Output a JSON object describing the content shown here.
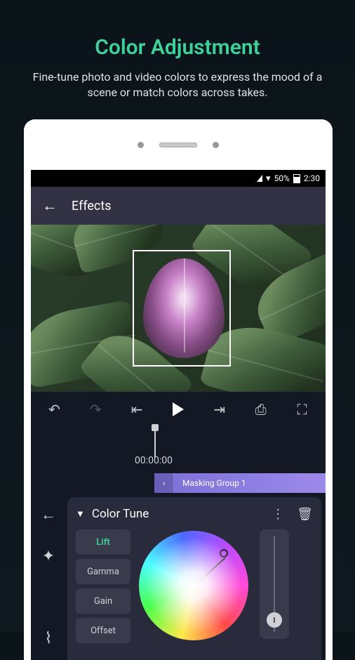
{
  "promo": {
    "title": "Color Adjustment",
    "subtitle": "Fine-tune photo and video colors to express the mood of a scene or match colors across takes."
  },
  "statusbar": {
    "battery": "50%",
    "time": "2:30"
  },
  "header": {
    "title": "Effects"
  },
  "timeline": {
    "timecode": "00:00:00",
    "track_name": "Masking Group 1"
  },
  "panel": {
    "title": "Color Tune",
    "tabs": [
      "Lift",
      "Gamma",
      "Gain",
      "Offset"
    ],
    "active_tab": "Lift"
  },
  "icons": {
    "back": "←",
    "undo": "↶",
    "redo": "↷",
    "skip_start": "⇤",
    "skip_end": "⇥",
    "bookmark": "⎙",
    "fullscreen": "⛶",
    "collapse_chevron": "‹",
    "panel_back": "←",
    "keyframe": "✦",
    "curve": "⌇",
    "dropdown": "▼",
    "more": "⋮",
    "trash": "🗑"
  }
}
